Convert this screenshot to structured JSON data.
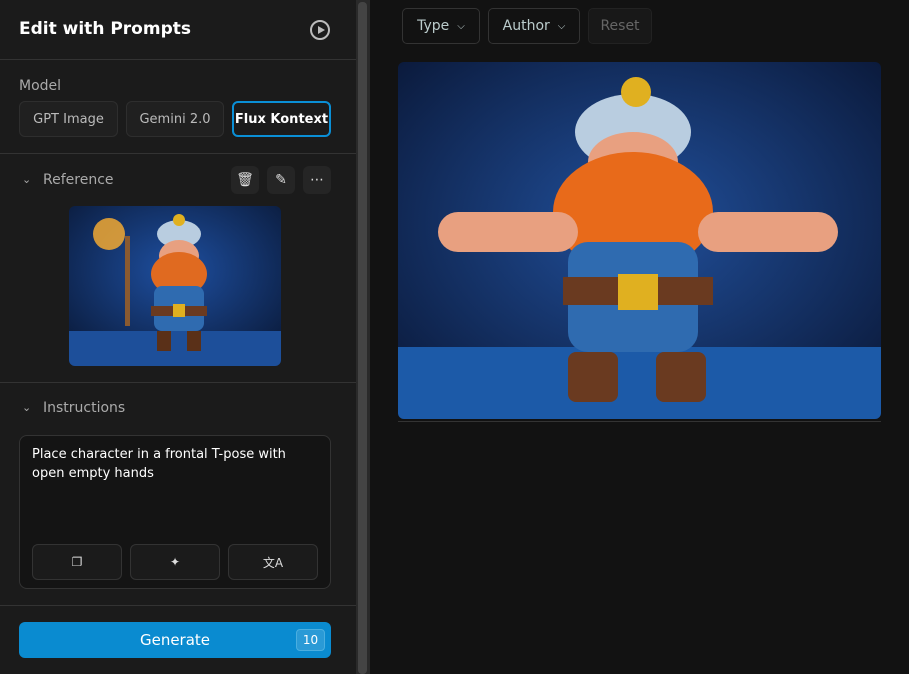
{
  "sidebar": {
    "title": "Edit with Prompts",
    "model_label": "Model",
    "models": [
      "GPT Image",
      "Gemini 2.0",
      "Flux Kontext"
    ],
    "selected_model": "Flux Kontext",
    "reference_label": "Reference",
    "instructions_label": "Instructions",
    "instructions_text": "Place character in a frontal T-pose with open empty hands",
    "generate_label": "Generate",
    "generate_count": "10"
  },
  "toolbar": {
    "type_label": "Type",
    "author_label": "Author",
    "reset_label": "Reset"
  },
  "colors": {
    "accent": "#0a8bd0",
    "sidebar_bg": "#1b1b1b",
    "main_bg": "#121212"
  }
}
